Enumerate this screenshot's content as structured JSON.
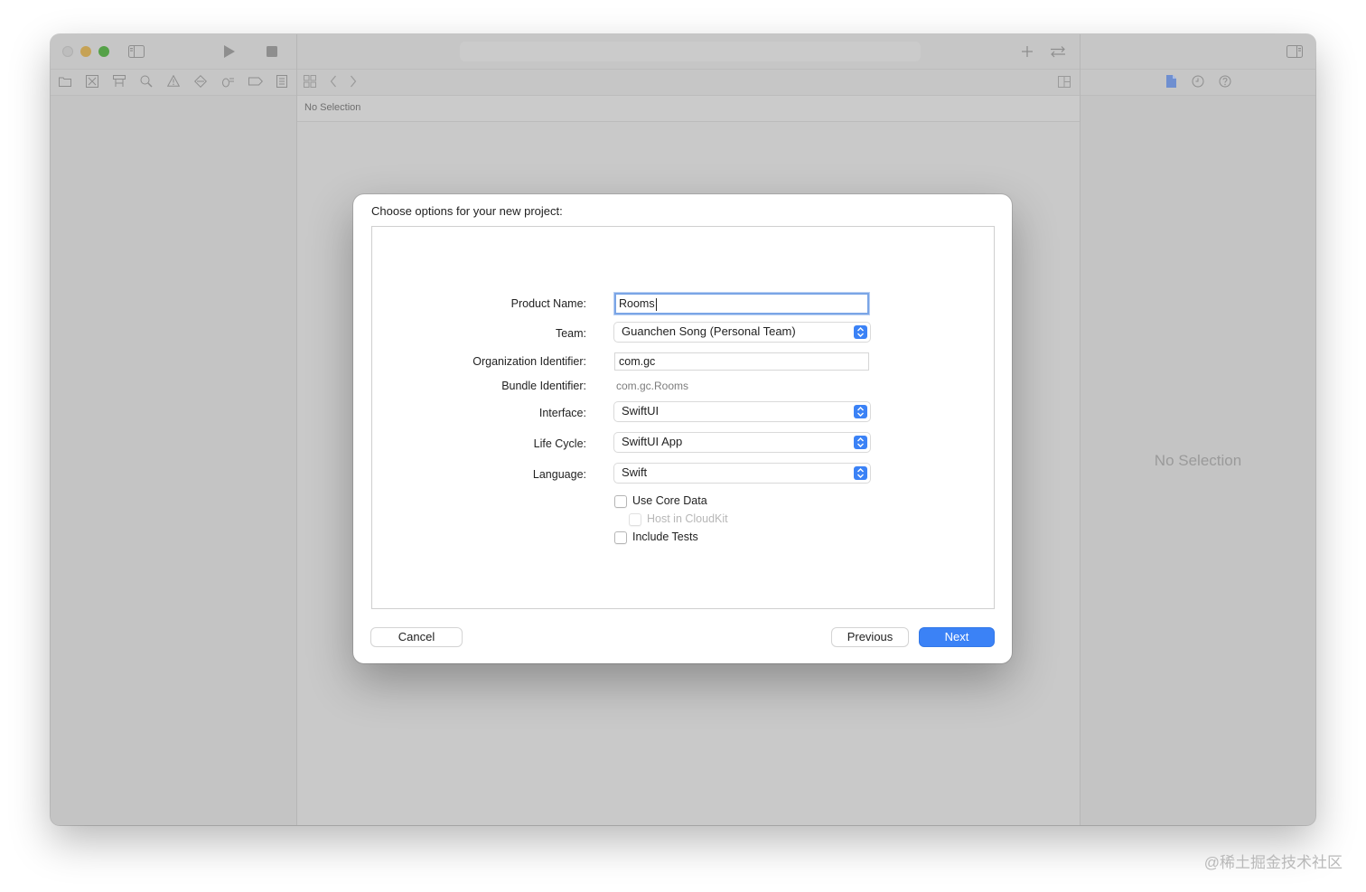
{
  "window": {
    "toolbar_icons": [
      "sidebar-toggle-icon",
      "play-icon",
      "stop-icon",
      "add-icon",
      "swap-icon",
      "inspector-toggle-icon"
    ],
    "navigator_icons": [
      "folder-icon",
      "source-control-icon",
      "symbol-icon",
      "search-icon",
      "warning-icon",
      "test-icon",
      "debug-icon",
      "breakpoint-icon",
      "report-icon"
    ],
    "editor_jumpbar": "No Selection",
    "inspector_icons": [
      "file-inspector-icon",
      "history-icon",
      "help-icon"
    ],
    "inspector_placeholder": "No Selection"
  },
  "dialog": {
    "title": "Choose options for your new project:",
    "fields": {
      "product_name": {
        "label": "Product Name:",
        "value": "Rooms"
      },
      "team": {
        "label": "Team:",
        "value": "Guanchen Song (Personal Team)"
      },
      "organization_identifier": {
        "label": "Organization Identifier:",
        "value": "com.gc"
      },
      "bundle_identifier": {
        "label": "Bundle Identifier:",
        "value": "com.gc.Rooms"
      },
      "interface": {
        "label": "Interface:",
        "value": "SwiftUI"
      },
      "life_cycle": {
        "label": "Life Cycle:",
        "value": "SwiftUI App"
      },
      "language": {
        "label": "Language:",
        "value": "Swift"
      }
    },
    "checkboxes": {
      "use_core_data": {
        "label": "Use Core Data",
        "checked": false
      },
      "host_in_cloudkit": {
        "label": "Host in CloudKit",
        "checked": false,
        "enabled": false
      },
      "include_tests": {
        "label": "Include Tests",
        "checked": false
      }
    },
    "buttons": {
      "cancel": "Cancel",
      "previous": "Previous",
      "next": "Next"
    },
    "accent_color": "#3b82f6"
  },
  "watermark": "@稀土掘金技术社区"
}
